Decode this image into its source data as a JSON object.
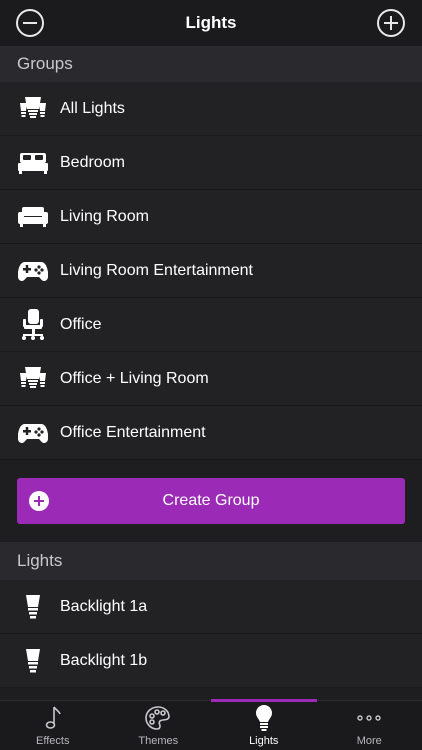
{
  "header": {
    "title": "Lights"
  },
  "groups_section": {
    "title": "Groups"
  },
  "groups": [
    {
      "label": "All Lights",
      "icon": "bulbs-icon"
    },
    {
      "label": "Bedroom",
      "icon": "bed-icon"
    },
    {
      "label": "Living Room",
      "icon": "sofa-icon"
    },
    {
      "label": "Living Room Entertainment",
      "icon": "gamepad-icon"
    },
    {
      "label": "Office",
      "icon": "office-chair-icon"
    },
    {
      "label": "Office + Living Room",
      "icon": "bulbs-icon"
    },
    {
      "label": "Office Entertainment",
      "icon": "gamepad-icon"
    }
  ],
  "create_group": {
    "label": "Create Group"
  },
  "lights_section": {
    "title": "Lights"
  },
  "lights": [
    {
      "label": "Backlight 1a",
      "icon": "bulb-icon"
    },
    {
      "label": "Backlight 1b",
      "icon": "bulb-icon"
    }
  ],
  "tabs": [
    {
      "label": "Effects",
      "icon": "music-note-icon",
      "active": false
    },
    {
      "label": "Themes",
      "icon": "palette-icon",
      "active": false
    },
    {
      "label": "Lights",
      "icon": "lightbulb-icon",
      "active": true
    },
    {
      "label": "More",
      "icon": "ellipsis-icon",
      "active": false
    }
  ],
  "colors": {
    "accent": "#9b2bb7",
    "background": "#1e1e21",
    "row": "#222225",
    "section": "#2a2a2e"
  }
}
